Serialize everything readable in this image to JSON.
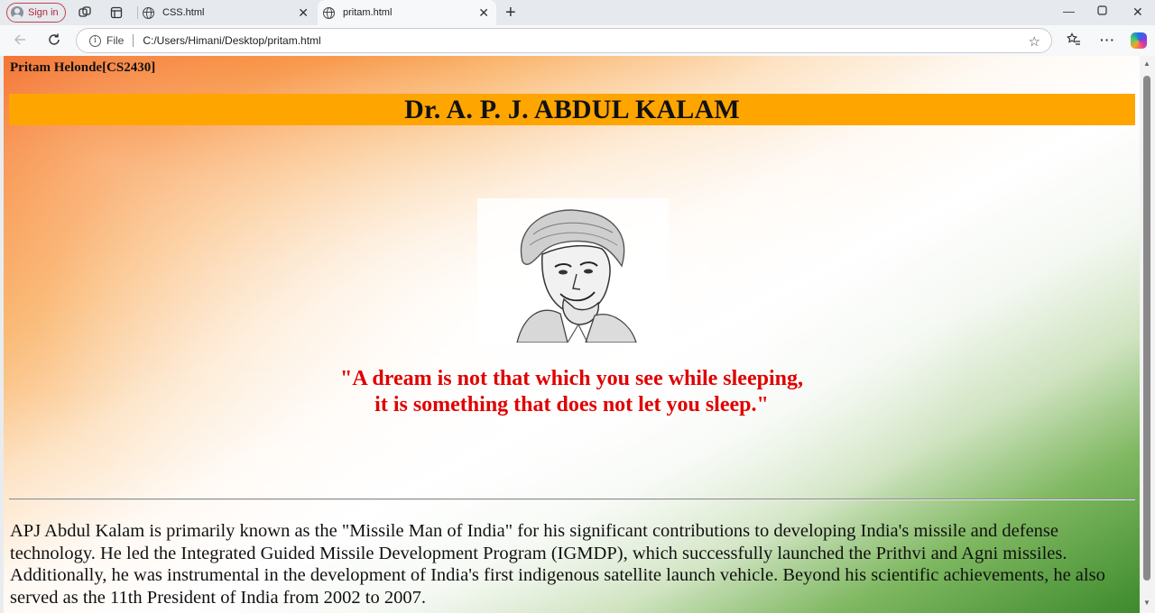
{
  "browser": {
    "signin_label": "Sign in",
    "tabs": [
      {
        "label": "CSS.html",
        "active": false
      },
      {
        "label": "pritam.html",
        "active": true
      }
    ],
    "address": {
      "scheme_label": "File",
      "url": "C:/Users/Himani/Desktop/pritam.html"
    },
    "icons": [
      "workspaces-icon",
      "tab-actions-icon",
      "globe-icon",
      "close-icon",
      "new-tab-icon",
      "minimize-icon",
      "maximize-icon",
      "window-close-icon",
      "back-icon",
      "refresh-icon",
      "info-icon",
      "favorite-star-icon",
      "favorites-icon",
      "more-icon",
      "copilot-icon"
    ]
  },
  "page": {
    "student_label": "Pritam Helonde[CS2430]",
    "title": "Dr. A. P. J. ABDUL KALAM",
    "quote_line1": "\"A dream is not that which you see while sleeping,",
    "quote_line2": "it is something that does not let you sleep.\"",
    "bio": "APJ Abdul Kalam is primarily known as the \"Missile Man of India\" for his significant contributions to developing India's missile and defense technology. He led the Integrated Guided Missile Development Program (IGMDP), which successfully launched the Prithvi and Agni missiles. Additionally, he was instrumental in the development of India's first indigenous satellite launch vehicle. Beyond his scientific achievements, he also served as the 11th President of India from 2002 to 2007.",
    "colors": {
      "title_bar": "#ffa500",
      "quote": "#e00000",
      "saffron": "#f25a0e",
      "green": "#3d8a2c"
    }
  }
}
